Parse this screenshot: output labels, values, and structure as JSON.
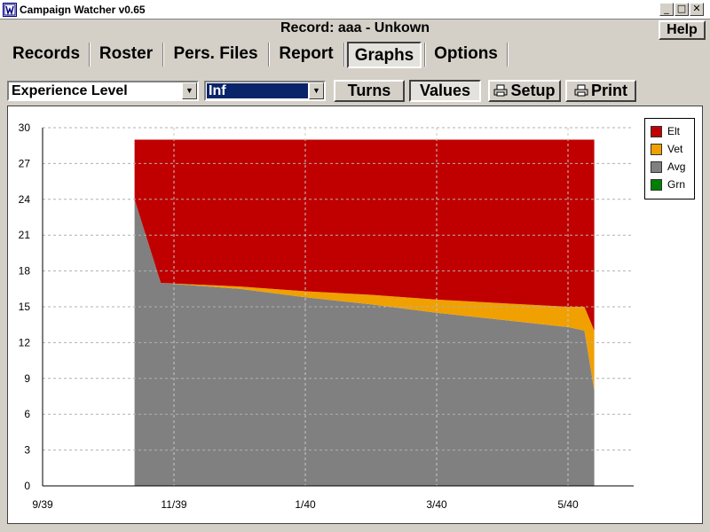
{
  "window": {
    "title": "Campaign Watcher v0.65",
    "minimize_glyph": "_",
    "maximize_glyph": "□",
    "close_glyph": "✕"
  },
  "header": {
    "record_title": "Record: aaa - Unkown",
    "help_label": "Help"
  },
  "tabs": [
    {
      "label": "Records",
      "active": false
    },
    {
      "label": "Roster",
      "active": false
    },
    {
      "label": "Pers. Files",
      "active": false
    },
    {
      "label": "Report",
      "active": false
    },
    {
      "label": "Graphs",
      "active": true
    },
    {
      "label": "Options",
      "active": false
    }
  ],
  "toolbar": {
    "metric_select": "Experience Level",
    "unit_select": "Inf",
    "turns_label": "Turns",
    "values_label": "Values",
    "setup_label": "Setup",
    "print_label": "Print"
  },
  "colors": {
    "elt": "#c00000",
    "vet": "#f0a000",
    "avg": "#808080",
    "grn": "#008000"
  },
  "chart_data": {
    "type": "area",
    "stacked": true,
    "ylim": [
      0,
      30
    ],
    "yticks": [
      0,
      3,
      6,
      9,
      12,
      15,
      18,
      21,
      24,
      27,
      30
    ],
    "xlim": [
      "9/39",
      "6/40"
    ],
    "xticks": [
      "9/39",
      "11/39",
      "1/40",
      "3/40",
      "5/40"
    ],
    "grid": true,
    "legend_position": "top-right",
    "x": [
      "10/39",
      "11/39",
      "12/39",
      "1/40",
      "2/40",
      "3/40",
      "4/40",
      "5/40",
      "5/40",
      "6/40"
    ],
    "series": [
      {
        "name": "Grn",
        "color": "#008000",
        "values": [
          0,
          0,
          0,
          0,
          0,
          0,
          0,
          0,
          0,
          0
        ]
      },
      {
        "name": "Avg",
        "color": "#808080",
        "values": [
          24,
          17,
          16.5,
          15.8,
          15.2,
          14.5,
          13.9,
          13.3,
          13.0,
          8
        ]
      },
      {
        "name": "Vet",
        "color": "#f0a000",
        "values": [
          0,
          0,
          0.2,
          0.5,
          0.8,
          1.1,
          1.4,
          1.7,
          2.0,
          5
        ]
      },
      {
        "name": "Elt",
        "color": "#c00000",
        "values": [
          5,
          12,
          12.3,
          12.7,
          13,
          13.4,
          13.7,
          14,
          14,
          16
        ]
      }
    ]
  },
  "legend": [
    {
      "label": "Elt",
      "color": "#c00000"
    },
    {
      "label": "Vet",
      "color": "#f0a000"
    },
    {
      "label": "Avg",
      "color": "#808080"
    },
    {
      "label": "Grn",
      "color": "#008000"
    }
  ]
}
